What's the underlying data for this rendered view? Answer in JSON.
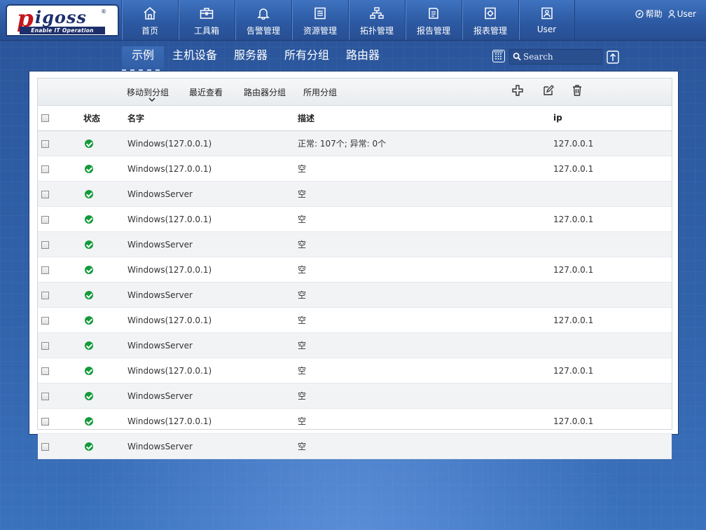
{
  "logo": {
    "mark": "p",
    "word": "igoss",
    "reg": "®",
    "tagline": "Enable IT Operation"
  },
  "nav": [
    {
      "label": "首页",
      "icon": "home-icon"
    },
    {
      "label": "工具箱",
      "icon": "toolbox-icon"
    },
    {
      "label": "告警管理",
      "icon": "bell-icon"
    },
    {
      "label": "资源管理",
      "icon": "resource-icon"
    },
    {
      "label": "拓扑管理",
      "icon": "topology-icon"
    },
    {
      "label": "报告管理",
      "icon": "report-icon"
    },
    {
      "label": "报表管理",
      "icon": "report-gear-icon"
    },
    {
      "label": "User",
      "icon": "user-card-icon"
    }
  ],
  "header": {
    "help": "帮助",
    "user": "User"
  },
  "tabs": [
    "示例",
    "主机设备",
    "服务器",
    "所有分组",
    "路由器"
  ],
  "search": {
    "placeholder": "Search"
  },
  "toolbar": {
    "move": "移动到分组",
    "recent": "最近查看",
    "router_group": "路由器分组",
    "used_group": "所用分组"
  },
  "table": {
    "headers": {
      "status": "状态",
      "name": "名字",
      "desc": "描述",
      "ip": "ip"
    },
    "rows": [
      {
        "name": "Windows(127.0.0.1)",
        "desc": "正常: 107个; 异常: 0个",
        "ip": "127.0.0.1"
      },
      {
        "name": "Windows(127.0.0.1)",
        "desc": "空",
        "ip": "127.0.0.1"
      },
      {
        "name": "WindowsServer",
        "desc": "空",
        "ip": ""
      },
      {
        "name": "Windows(127.0.0.1)",
        "desc": "空",
        "ip": "127.0.0.1"
      },
      {
        "name": "WindowsServer",
        "desc": "空",
        "ip": ""
      },
      {
        "name": "Windows(127.0.0.1)",
        "desc": "空",
        "ip": "127.0.0.1"
      },
      {
        "name": "WindowsServer",
        "desc": "空",
        "ip": ""
      },
      {
        "name": "Windows(127.0.0.1)",
        "desc": "空",
        "ip": "127.0.0.1"
      },
      {
        "name": "WindowsServer",
        "desc": "空",
        "ip": ""
      },
      {
        "name": "Windows(127.0.0.1)",
        "desc": "空",
        "ip": "127.0.0.1"
      },
      {
        "name": "WindowsServer",
        "desc": "空",
        "ip": ""
      },
      {
        "name": "Windows(127.0.0.1)",
        "desc": "空",
        "ip": "127.0.0.1"
      },
      {
        "name": "WindowsServer",
        "desc": "空",
        "ip": ""
      }
    ]
  }
}
